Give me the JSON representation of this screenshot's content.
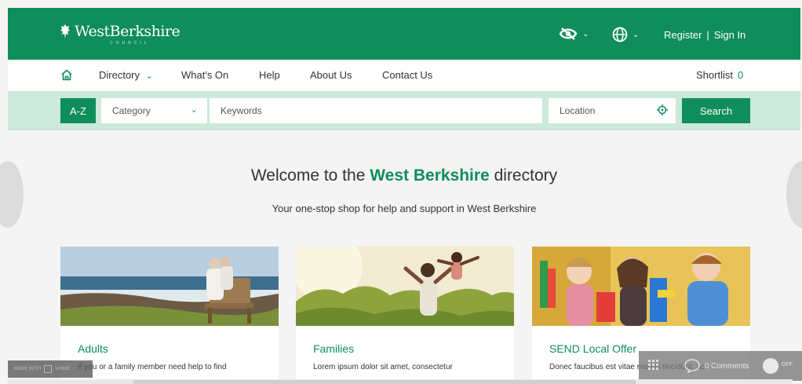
{
  "header": {
    "logo_text": "WestBerkshire",
    "logo_subtext": "COUNCIL",
    "icons": [
      "accessibility-eye-icon",
      "globe-icon"
    ],
    "register_label": "Register",
    "separator": "|",
    "signin_label": "Sign In"
  },
  "nav": {
    "home_icon": "home-icon",
    "items": [
      {
        "label": "Directory"
      },
      {
        "label": "What's On"
      },
      {
        "label": "Help"
      },
      {
        "label": "About Us"
      },
      {
        "label": "Contact Us"
      }
    ],
    "shortlist_label": "Shortlist",
    "shortlist_count": "0"
  },
  "search": {
    "az_label": "A-Z",
    "category_placeholder": "Category",
    "keywords_placeholder": "Keywords",
    "location_placeholder": "Location",
    "search_label": "Search"
  },
  "hero": {
    "welcome_prefix": "Welcome to the",
    "welcome_brand": "West Berkshire",
    "welcome_suffix": "directory",
    "subtitle": "Your one-stop shop for help and support in West Berkshire"
  },
  "cards": [
    {
      "title": "Adults",
      "text": "If you or a family member need help to find"
    },
    {
      "title": "Families",
      "text": "Lorem ipsum dolor sit amet, consectetur"
    },
    {
      "title": "SEND Local Offer",
      "text": "Donec faucibus est vitae mauris tincidunt, ac"
    }
  ],
  "overlay": {
    "made_with": "MADE WITH",
    "made_with_brand": "VISME",
    "comments_label": "Comments",
    "comments_count": "0",
    "toggle_label": "OFF"
  },
  "colors": {
    "brand_green": "#0f8d5b",
    "search_band": "#cce9db",
    "page_bg": "#f4f4f4"
  }
}
